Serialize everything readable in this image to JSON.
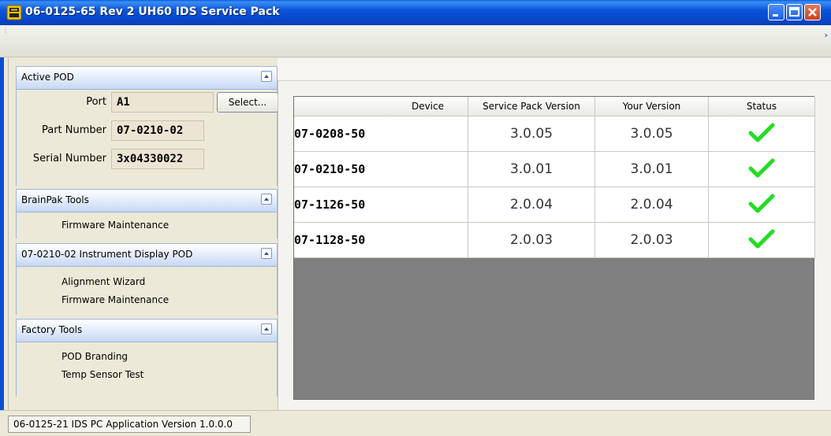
{
  "window": {
    "title": "06-0125-65 Rev 2 UH60 IDS Service Pack",
    "buttons": {
      "minimize": "minimize-icon",
      "maximize": "maximize-icon",
      "close": "close-icon"
    }
  },
  "sidebar": {
    "active_pod": {
      "title": "Active POD",
      "port_label": "Port",
      "port_value": "A1",
      "select_label": "Select...",
      "part_label": "Part Number",
      "part_value": "07-0210-02",
      "serial_label": "Serial Number",
      "serial_value": "3x04330022"
    },
    "brainpak": {
      "title": "BrainPak Tools",
      "items": [
        "Firmware Maintenance"
      ]
    },
    "instrument": {
      "title": "07-0210-02 Instrument Display POD",
      "items": [
        "Alignment Wizard",
        "Firmware Maintenance"
      ]
    },
    "factory": {
      "title": "Factory Tools",
      "items": [
        "POD Branding",
        "Temp Sensor Test"
      ]
    }
  },
  "table": {
    "columns": [
      "Device",
      "Service Pack Version",
      "Your Version",
      "Status"
    ],
    "rows": [
      {
        "device": "07-0208-50",
        "sp_version": "3.0.05",
        "your_version": "3.0.05",
        "status": "ok"
      },
      {
        "device": "07-0210-50",
        "sp_version": "3.0.01",
        "your_version": "3.0.01",
        "status": "ok"
      },
      {
        "device": "07-1126-50",
        "sp_version": "2.0.04",
        "your_version": "2.0.04",
        "status": "ok"
      },
      {
        "device": "07-1128-50",
        "sp_version": "2.0.03",
        "your_version": "2.0.03",
        "status": "ok"
      }
    ]
  },
  "statusbar": {
    "text": "06-0125-21 IDS PC Application Version 1.0.0.0"
  },
  "colors": {
    "check": "#22dd22",
    "titlebar": "#0a55d8"
  }
}
